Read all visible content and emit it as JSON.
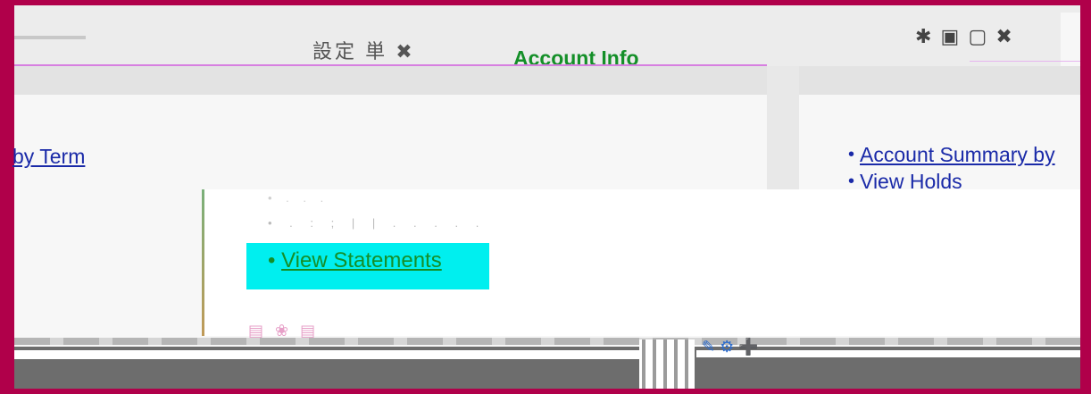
{
  "header": {
    "title": "Account Info",
    "glyphs_left": "設定 単 ✖",
    "glyphs_right": "✱ ▣ ▢ ✖"
  },
  "links": {
    "term": "by Term",
    "account_summary": "Account Summary by",
    "view_holds": "View Holds"
  },
  "popup": {
    "faint_line_1": "• . . .",
    "faint_line_2": "• . : ; | | . . . . .",
    "view_statements": "View Statements",
    "icons": "▤ ❀ ▤"
  },
  "taskbar": {
    "icons": "✎ ⚙ ➕"
  },
  "colors": {
    "border": "#b0004a",
    "title_green": "#148f28",
    "link_blue": "#1a2aa8",
    "highlight": "#00efef"
  }
}
